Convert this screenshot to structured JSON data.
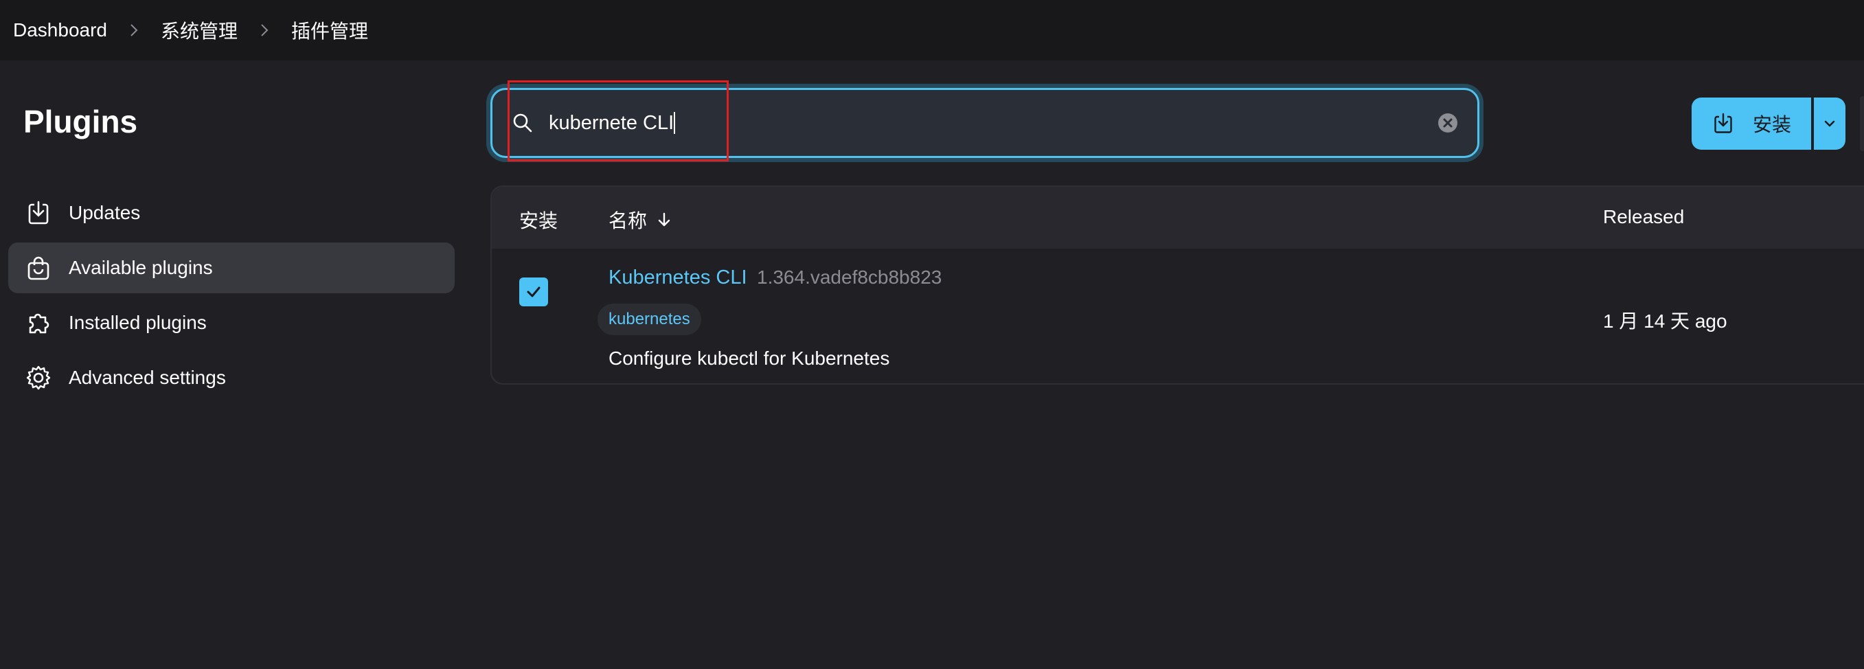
{
  "breadcrumb": [
    "Dashboard",
    "系统管理",
    "插件管理"
  ],
  "sidebar": {
    "title": "Plugins",
    "items": [
      {
        "label": "Updates",
        "icon": "download-icon",
        "active": false
      },
      {
        "label": "Available plugins",
        "icon": "shopping-bag-icon",
        "active": true
      },
      {
        "label": "Installed plugins",
        "icon": "puzzle-icon",
        "active": false
      },
      {
        "label": "Advanced settings",
        "icon": "gear-icon",
        "active": false
      }
    ]
  },
  "search": {
    "value": "kubernete CLI",
    "icon": "search-icon",
    "clear_icon": "clear-icon"
  },
  "install_button": {
    "label": "安装",
    "icon": "download-icon",
    "dropdown_icon": "chevron-down-icon"
  },
  "table": {
    "columns": {
      "install": "安装",
      "name": "名称",
      "released": "Released"
    },
    "rows": [
      {
        "checked": true,
        "name": "Kubernetes CLI",
        "version": "1.364.vadef8cb8b823",
        "tag": "kubernetes",
        "description": "Configure kubectl for Kubernetes",
        "released": "1 月 14 天 ago"
      }
    ]
  },
  "colors": {
    "accent": "#4cc2f5",
    "link": "#5bc8f7",
    "background": "#1f1f24",
    "highlight_box": "#e02020"
  }
}
